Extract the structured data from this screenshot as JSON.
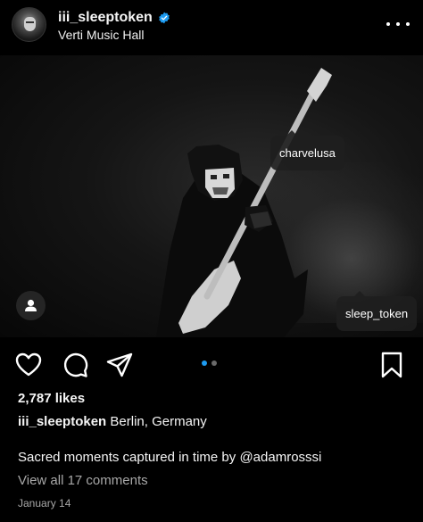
{
  "header": {
    "username": "iii_sleeptoken",
    "location": "Verti Music Hall"
  },
  "icons": {
    "verified": "verified-badge-icon",
    "more": "more-options-icon",
    "like": "heart-icon",
    "comment": "comment-icon",
    "share": "send-icon",
    "save": "bookmark-icon",
    "tagged_users": "person-icon"
  },
  "photo": {
    "tags": [
      "charvelusa",
      "sleep_token"
    ]
  },
  "carousel": {
    "current": 1,
    "total": 2,
    "active_color": "#1d9bf0",
    "inactive_color": "#6a6a6a"
  },
  "post": {
    "likes": "2,787 likes",
    "caption_username": "iii_sleeptoken",
    "caption_location": "Berlin, Germany",
    "caption_text": "Sacred moments captured in time by ",
    "caption_mention": "@adamrosssi",
    "comments_link": "View all 17 comments",
    "date": "January 14"
  },
  "colors": {
    "background": "#000000",
    "verified": "#1d9bf0",
    "secondary_text": "#a8a8a8"
  }
}
